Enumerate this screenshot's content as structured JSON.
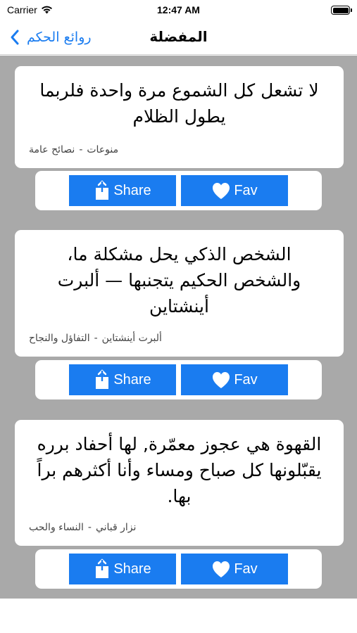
{
  "status_bar": {
    "carrier": "Carrier",
    "time": "12:47 AM"
  },
  "nav": {
    "back_label": "روائع الحكم",
    "title": "المفضلة"
  },
  "buttons": {
    "share_label": "Share",
    "fav_label": "Fav"
  },
  "colors": {
    "accent": "#1a7cf0",
    "background": "#a9a9a9"
  },
  "quotes": [
    {
      "text": "لا تشعل كل الشموع مرة واحدة فلربما يطول الظلام",
      "category": "منوعات",
      "subcategory": "نصائح عامة"
    },
    {
      "text": "الشخص الذكي يحل مشكلة ما، والشخص الحكيم يتجنبها — ألبرت أينشتاين",
      "category": "ألبرت أينشتاين",
      "subcategory": "التفاؤل والنجاح"
    },
    {
      "text": "القهوة هي عجوز معمّرة, لها أحفاد برره يقبّلونها كل صباح ومساء وأنا أكثرهم براً بها.",
      "category": "نزار قباني",
      "subcategory": "النساء والحب"
    }
  ]
}
